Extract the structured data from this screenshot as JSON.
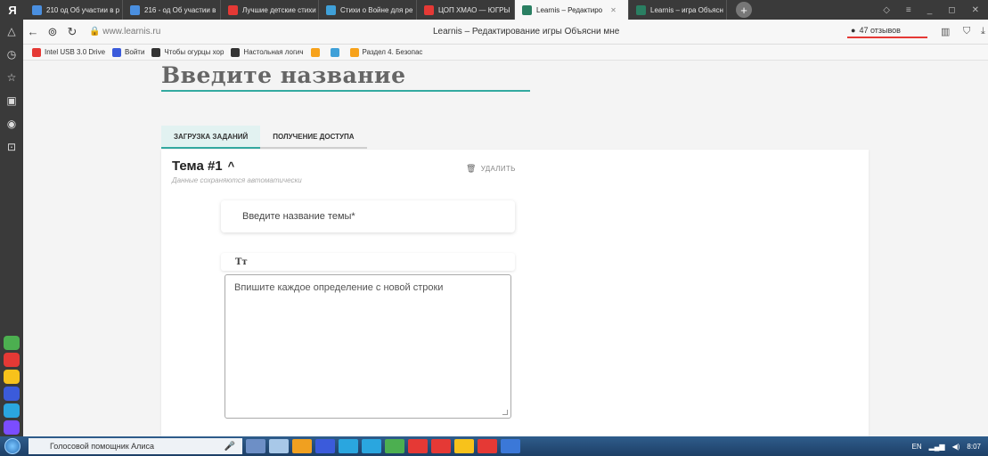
{
  "browser": {
    "logo": "Я",
    "tabs": [
      {
        "label": "210 од Об участии в р",
        "color": "#4a8fe0"
      },
      {
        "label": "216 - од Об участии в",
        "color": "#4a8fe0"
      },
      {
        "label": "Лучшие детские стихи",
        "color": "#e53935"
      },
      {
        "label": "Стихи о Войне для ре",
        "color": "#3fa0d8"
      },
      {
        "label": "ЦОП ХМАО — ЮГРЫ",
        "color": "#e53935"
      },
      {
        "label": "Learnis – Редактиро",
        "color": "#2a7f62",
        "active": true
      },
      {
        "label": "Learnis – игра Объясн",
        "color": "#2a7f62"
      }
    ],
    "new_tab": "+",
    "url": "www.learnis.ru",
    "page_title": "Learnis – Редактирование игры Объясни мне",
    "reviews": "47 отзывов",
    "bookmarks": [
      {
        "label": "Intel USB 3.0 Drive",
        "color": "#e53935"
      },
      {
        "label": "Войти",
        "color": "#3b5bdb"
      },
      {
        "label": "Чтобы огурцы хор",
        "color": "#333"
      },
      {
        "label": "Настольная логич",
        "color": "#333"
      },
      {
        "label": "",
        "color": "#f7a21b"
      },
      {
        "label": "",
        "color": "#3fa0d8"
      },
      {
        "label": "Раздел 4. Безопас",
        "color": "#f7a21b"
      }
    ]
  },
  "sidebar_apps": [
    "#4caf50",
    "#e53935",
    "#f7c21b",
    "#3b5bdb",
    "#2aa6df",
    "#7b4dff"
  ],
  "game": {
    "title": "Введите название",
    "tabs": [
      "ЗАГРУЗКА ЗАДАНИЙ",
      "ПОЛУЧЕНИЕ ДОСТУПА"
    ],
    "theme": {
      "title": "Тема #1",
      "autosave": "Данные сохраняются автоматически",
      "delete": "УДАЛИТЬ",
      "topic_placeholder": "Введите название темы*",
      "text_tool": "Tт",
      "definitions_placeholder": "Впишите каждое определение с новой строки"
    }
  },
  "taskbar": {
    "alice": "Голосовой помощник Алиса",
    "lang": "EN",
    "time": "8:07",
    "icon_colors": [
      "#6d8fc6",
      "#a8c8e8",
      "#f0a020",
      "#3b5bdb",
      "#2aa6df",
      "#2aa6df",
      "#4caf50",
      "#e53935",
      "#e53935",
      "#f7c21b",
      "#e53935",
      "#3b78d8"
    ]
  }
}
